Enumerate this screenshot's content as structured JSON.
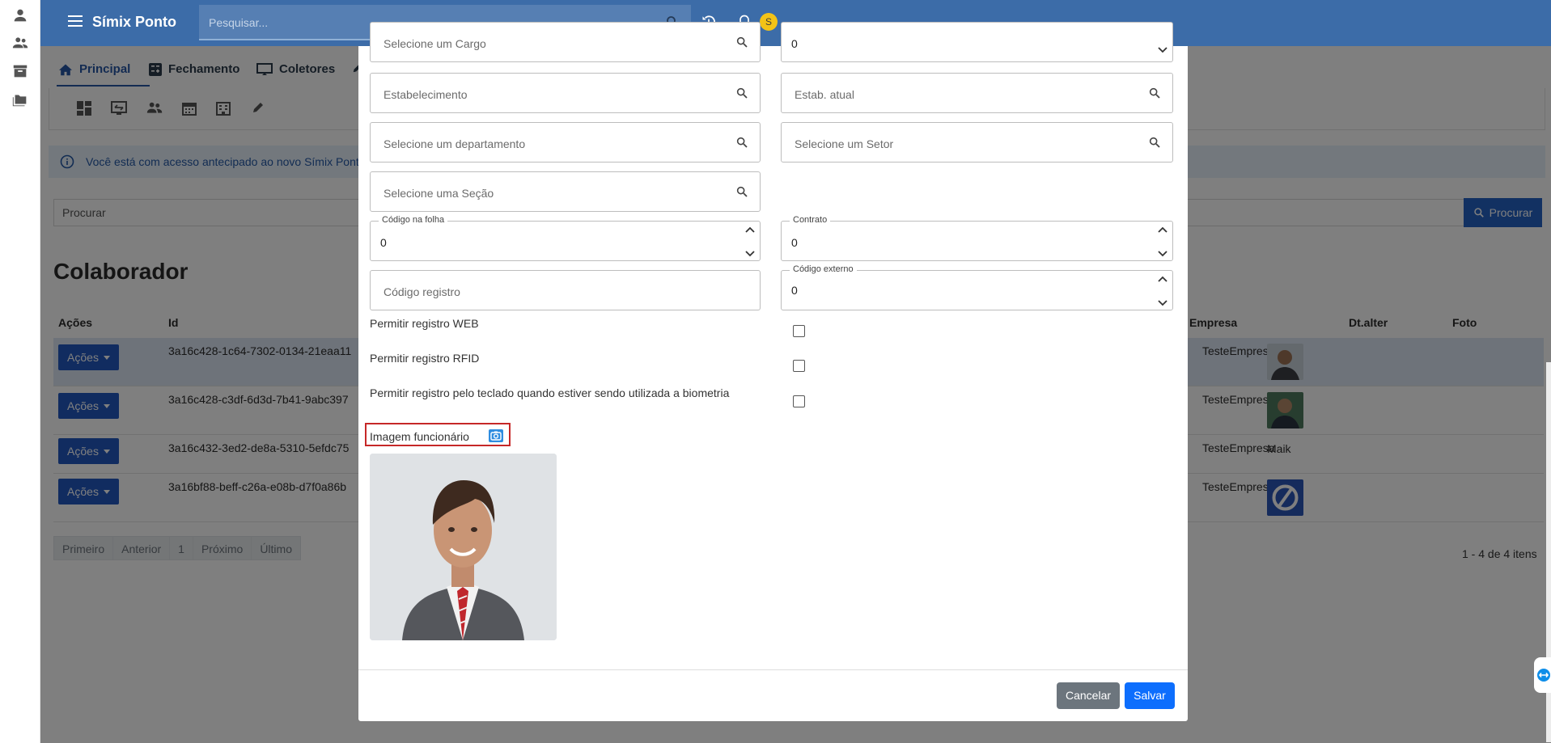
{
  "app": {
    "title": "Símix Ponto",
    "search_placeholder": "Pesquisar...",
    "avatar_letter": "S",
    "accent": "#3c6ca8"
  },
  "tabs": [
    {
      "label": "Principal",
      "icon": "home-icon"
    },
    {
      "label": "Fechamento",
      "icon": "calculator-icon"
    },
    {
      "label": "Coletores",
      "icon": "monitor-icon"
    }
  ],
  "info_banner": "Você está com acesso antecipado ao novo Símix Ponto",
  "filter": {
    "placeholder": "Procurar",
    "button": "Procurar"
  },
  "page_title": "Colaborador",
  "table": {
    "headers": {
      "acoes": "Ações",
      "id": "Id",
      "empresa": "Empresa",
      "dtalter": "Dt.alter",
      "foto": "Foto"
    },
    "action_label": "Ações",
    "rows": [
      {
        "id": "3a16c428-1c64-7302-0134-21eaa11",
        "empresa": "TesteEmpresa",
        "foto_alt": ""
      },
      {
        "id": "3a16c428-c3df-6d3d-7b41-9abc397",
        "empresa": "TesteEmpresa",
        "foto_alt": ""
      },
      {
        "id": "3a16c432-3ed2-de8a-5310-5efdc75",
        "empresa": "TesteEmpresa",
        "foto_alt": "Maik"
      },
      {
        "id": "3a16bf88-beff-c26a-e08b-d7f0a86b",
        "empresa": "TesteEmpresa",
        "foto_alt": ""
      }
    ]
  },
  "pager": {
    "first": "Primeiro",
    "prev": "Anterior",
    "page": "1",
    "next": "Próximo",
    "last": "Último",
    "count": "1 - 4 de 4 itens"
  },
  "modal": {
    "cargo_placeholder": "Selecione um Cargo",
    "cargo_value": "0",
    "estabelecimento": "Estabelecimento",
    "estab_atual": "Estab. atual",
    "departamento": "Selecione um departamento",
    "setor": "Selecione um Setor",
    "secao": "Selecione uma Seção",
    "codigo_folha_label": "Código na folha",
    "codigo_folha_value": "0",
    "contrato_label": "Contrato",
    "contrato_value": "0",
    "codigo_registro": "Código registro",
    "codigo_externo_label": "Código externo",
    "codigo_externo_value": "0",
    "perm_web": "Permitir registro WEB",
    "perm_rfid": "Permitir registro RFID",
    "perm_teclado": "Permitir registro pelo teclado quando estiver sendo utilizada a biometria",
    "imagem_label": "Imagem funcionário",
    "cancel": "Cancelar",
    "save": "Salvar"
  }
}
